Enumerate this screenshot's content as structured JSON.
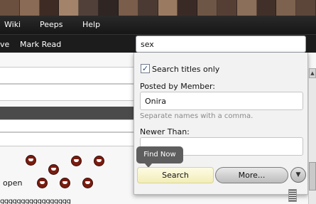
{
  "banner": {
    "tile_colors": [
      "#6b4f3f",
      "#8a6b55",
      "#3d2b24",
      "#a3846b",
      "#51403a",
      "#2f2522",
      "#7a5d4b",
      "#4a3a33",
      "#9a7b62",
      "#3a2a26",
      "#6e5646",
      "#553f35",
      "#8c6f5a",
      "#413029",
      "#7d624f",
      "#5c463a"
    ]
  },
  "nav": {
    "items": [
      "Wiki",
      "Peeps",
      "Help"
    ]
  },
  "subnav": {
    "partial_label": "ve",
    "mark_read": "Mark Read"
  },
  "search": {
    "query": "sex"
  },
  "search_panel": {
    "titles_only_checked": true,
    "titles_only_label": "Search titles only",
    "posted_by_label": "Posted by Member:",
    "posted_by_value": "Onira",
    "separate_hint": "Separate names with a comma.",
    "newer_than_label": "Newer Than:",
    "newer_than_value": "",
    "tooltip": "Find Now",
    "search_button": "Search",
    "more_button": "More...",
    "arrow_glyph": "▼"
  },
  "background": {
    "open_text": "open",
    "partial_text": "ggggggggggggggggg"
  },
  "scrollbar": {
    "up_glyph": "▲",
    "down_glyph": "▼"
  },
  "colors": {
    "nav_bg": "#161616",
    "accent_search_button": "#f2eeb8",
    "panel_bg": "#f2f2f2"
  }
}
